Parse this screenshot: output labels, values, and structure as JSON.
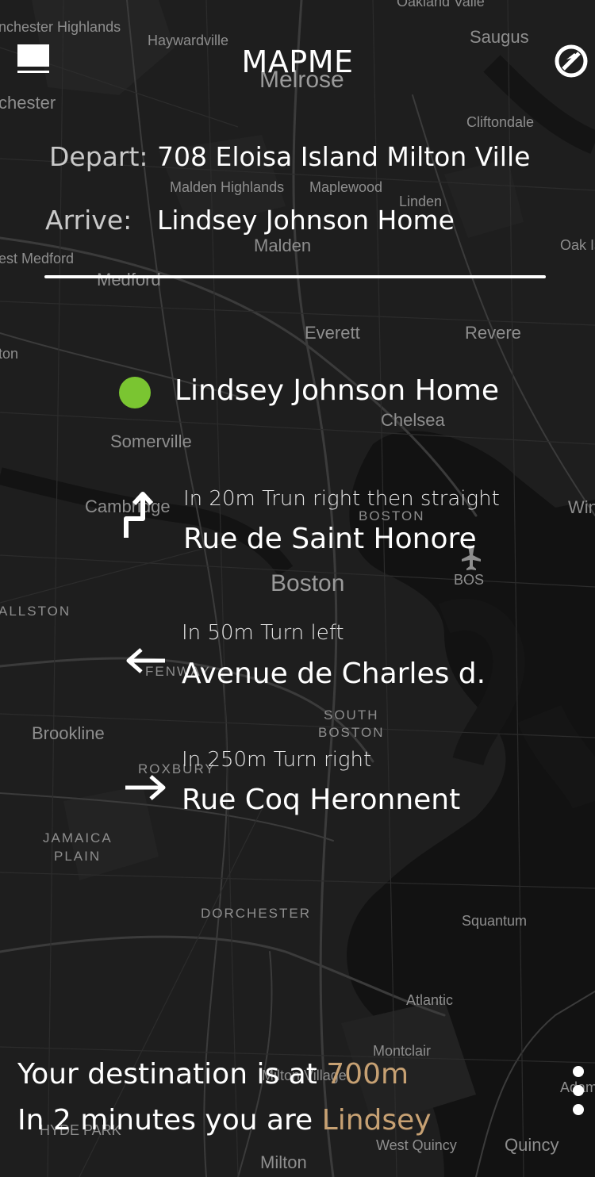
{
  "colors": {
    "accent": "#c7a173",
    "destination_dot": "#7ac531",
    "map_background": "#1d1d1d"
  },
  "header": {
    "title": "MAPME",
    "menu_icon": "menu-icon",
    "compass_icon": "compass-off-icon"
  },
  "route": {
    "depart_label": "Depart:",
    "depart_value": "708 Eloisa Island Milton Ville",
    "arrive_label": "Arrive:",
    "arrive_value": "Lindsey Johnson Home"
  },
  "destination": {
    "name": "Lindsey Johnson Home"
  },
  "steps": [
    {
      "icon": "turn-right-then-straight-icon",
      "hint": "In 20m Trun right then straight",
      "street": "Rue de Saint Honore"
    },
    {
      "icon": "arrow-left-icon",
      "hint": "In 50m Turn left",
      "street": "Avenue de Charles d."
    },
    {
      "icon": "arrow-right-icon",
      "hint": "In 250m Turn right",
      "street": "Rue Coq Heronnent"
    }
  ],
  "footer": {
    "line1_prefix": "Your destination is at ",
    "line1_value": "700m",
    "line2_prefix": "In 2 minutes you are ",
    "line2_value": "Lindsey",
    "more_icon": "more-vertical-icon"
  },
  "map_labels": [
    "Oakland Valle",
    "nchester Highlands",
    "Haywardville",
    "Saugus",
    "Melrose",
    "chester",
    "Cliftondale",
    "Maplewood",
    "Malden Highlands",
    "Linden",
    "Malden",
    "est Medford",
    "Medford",
    "Oak Is",
    "Everett",
    "Revere",
    "ton",
    "Chelsea",
    "Somerville",
    "Cambridge",
    "BOSTON",
    "Win",
    "BOS",
    "Boston",
    "ALLSTON",
    "FENWAY",
    "Brookline",
    "SOUTH",
    "BOSTON",
    "ROXBURY",
    "JAMAICA",
    "PLAIN",
    "DORCHESTER",
    "Squantum",
    "Atlantic",
    "Montclair",
    "Milton Village",
    "HYDE PARK",
    "Adams",
    "West Quincy",
    "Quincy",
    "Milton"
  ]
}
